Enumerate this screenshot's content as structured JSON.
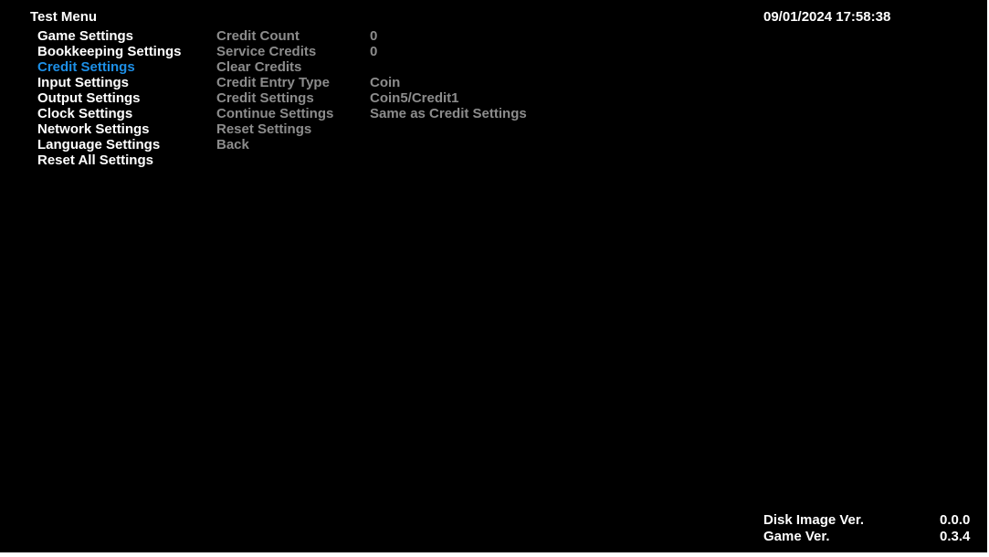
{
  "header": {
    "title": "Test Menu",
    "datetime": "09/01/2024 17:58:38"
  },
  "colors": {
    "background": "#000000",
    "text": "#ffffff",
    "selected": "#1d8fe6",
    "disabled": "#8c8c8c"
  },
  "menu": {
    "selected_index": 2,
    "items": [
      {
        "label": "Game Settings"
      },
      {
        "label": "Bookkeeping Settings"
      },
      {
        "label": "Credit Settings"
      },
      {
        "label": "Input Settings"
      },
      {
        "label": "Output Settings"
      },
      {
        "label": "Clock Settings"
      },
      {
        "label": "Network Settings"
      },
      {
        "label": "Language Settings"
      },
      {
        "label": "Reset All Settings"
      }
    ]
  },
  "credit_settings": {
    "rows": [
      {
        "label": "Credit Count",
        "value": "0"
      },
      {
        "label": "Service Credits",
        "value": "0"
      },
      {
        "label": "Clear Credits",
        "value": ""
      },
      {
        "label": "Credit Entry Type",
        "value": "Coin"
      },
      {
        "label": "Credit Settings",
        "value": "Coin5/Credit1"
      },
      {
        "label": "Continue Settings",
        "value": "Same as Credit Settings"
      },
      {
        "label": "Reset Settings",
        "value": ""
      },
      {
        "label": "Back",
        "value": ""
      }
    ]
  },
  "version_info": {
    "disk_image_label": "Disk Image Ver.",
    "disk_image_value": "0.0.0",
    "game_label": "Game Ver.",
    "game_value": "0.3.4"
  }
}
